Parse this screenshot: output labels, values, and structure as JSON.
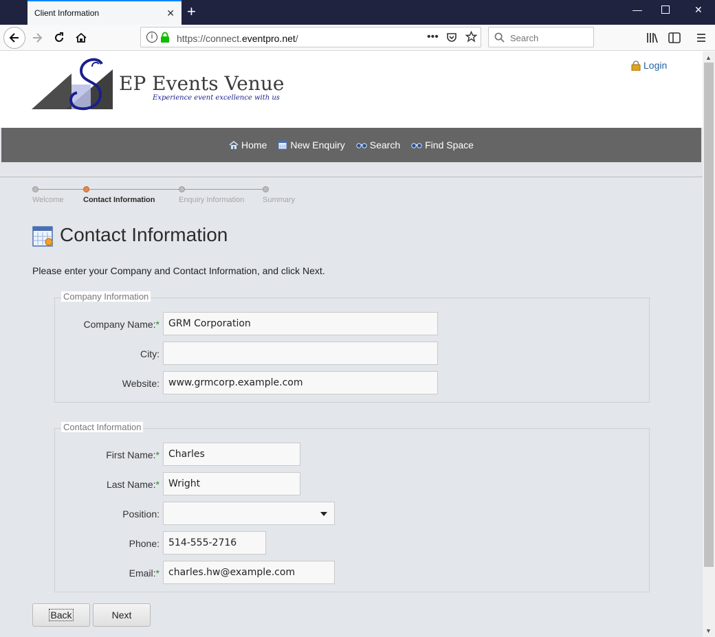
{
  "browser": {
    "tab_title": "Client Information",
    "url_host_prefix": "https://connect.",
    "url_domain": "eventpro.net",
    "url_path": "/",
    "search_placeholder": "Search"
  },
  "site": {
    "title": "EP Events Venue",
    "tagline": "Experience event excellence with us",
    "login_label": "Login"
  },
  "menu": {
    "items": [
      {
        "label": "Home",
        "icon": "home-icon"
      },
      {
        "label": "New Enquiry",
        "icon": "calendar-icon"
      },
      {
        "label": "Search",
        "icon": "binoculars-icon"
      },
      {
        "label": "Find Space",
        "icon": "binoculars-icon"
      }
    ]
  },
  "wizard": {
    "steps": [
      "Welcome",
      "Contact Information",
      "Enquiry Information",
      "Summary"
    ],
    "active_step": "Contact Information"
  },
  "main": {
    "title": "Contact Information",
    "intro": "Please enter your Company and Contact Information, and click Next."
  },
  "company": {
    "legend": "Company Information",
    "company_name_label": "Company Name:",
    "company_name_value": "GRM Corporation",
    "city_label": "City:",
    "city_value": "",
    "website_label": "Website:",
    "website_value": "www.grmcorp.example.com"
  },
  "contact": {
    "legend": "Contact Information",
    "first_name_label": "First Name:",
    "first_name_value": "Charles",
    "last_name_label": "Last Name:",
    "last_name_value": "Wright",
    "position_label": "Position:",
    "position_value": "",
    "phone_label": "Phone:",
    "phone_value": "514-555-2716",
    "email_label": "Email:",
    "email_value": "charles.hw@example.com"
  },
  "buttons": {
    "back": "Back",
    "next": "Next"
  },
  "colors": {
    "tabbar": "#202340",
    "menubar": "#656565",
    "page_bg": "#e3e6ea",
    "active_step": "#e6884a",
    "link": "#2262a3"
  }
}
